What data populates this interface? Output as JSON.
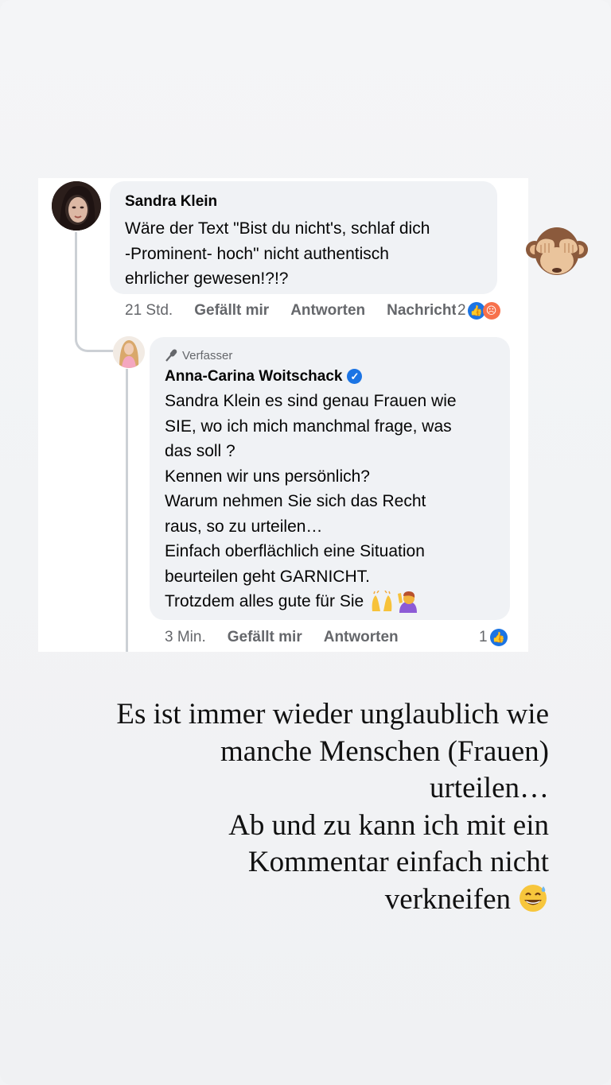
{
  "comment": {
    "author": "Sandra Klein",
    "text": "Wäre der Text \"Bist du nicht's, schlaf dich\n-Prominent- hoch\" nicht authentisch\nehrlicher gewesen!?!?",
    "time": "21 Std.",
    "like": "Gefällt mir",
    "reply": "Antworten",
    "message": "Nachricht",
    "reaction_count": "2"
  },
  "reply": {
    "badge": "Verfasser",
    "author": "Anna-Carina Woitschack",
    "lines": [
      "Sandra Klein es sind genau Frauen wie",
      "SIE, wo ich mich manchmal frage, was",
      "das soll ?",
      "Kennen wir uns persönlich?",
      "Warum nehmen Sie sich das Recht",
      "raus, so zu urteilen…",
      "Einfach oberflächlich eine Situation",
      "beurteilen geht GARNICHT.",
      "Trotzdem alles gute für Sie"
    ],
    "time": "3 Min.",
    "like": "Gefällt mir",
    "reply": "Antworten",
    "reaction_count": "1"
  },
  "caption": {
    "lines": [
      "Es ist immer wieder unglaublich wie",
      "manche Menschen (Frauen)",
      "urteilen…",
      "Ab und zu kann ich mit ein",
      "Kommentar einfach nicht",
      "verkneifen"
    ]
  },
  "colors": {
    "bubble": "#f0f2f5",
    "link_blue": "#1b74e4",
    "meta_gray": "#65676b"
  },
  "icons": {
    "story_sticker": "see-no-evil-monkey-emoji",
    "caption_end": "grinning-sweat-emoji",
    "reply_end": [
      "raising-hands-emoji",
      "person-raising-hand-emoji"
    ]
  }
}
